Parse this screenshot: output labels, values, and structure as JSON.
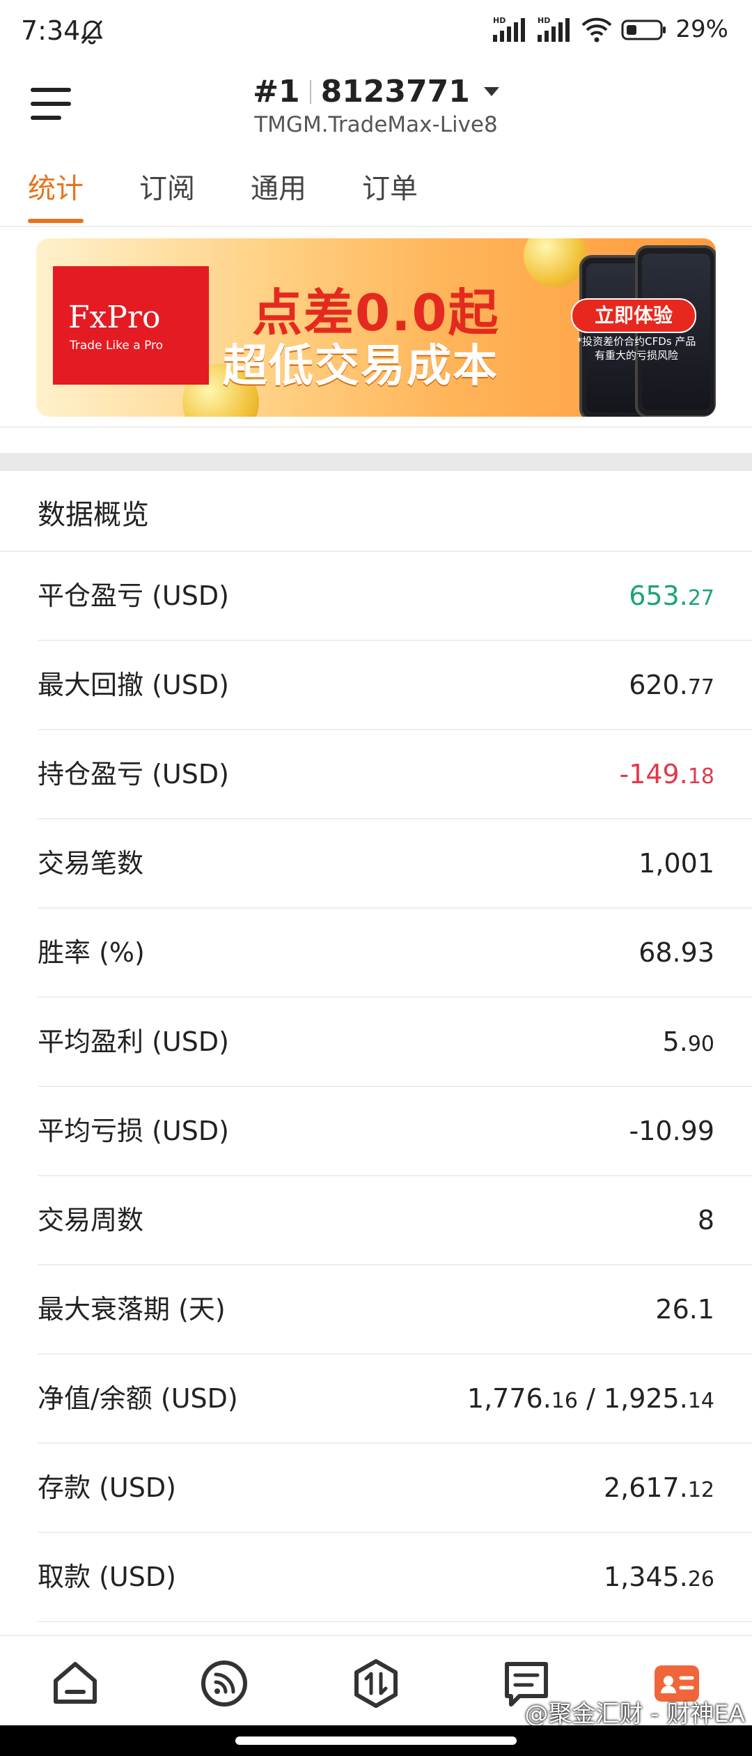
{
  "status_bar": {
    "time": "7:34",
    "battery": "29%",
    "signal_labels": [
      "HD",
      "HD"
    ],
    "icons": [
      "bell-off-icon",
      "signal-icon",
      "signal-icon",
      "wifi-icon",
      "battery-icon"
    ]
  },
  "header": {
    "account_prefix": "#1",
    "account_number": "8123771",
    "server": "TMGM.TradeMax-Live8"
  },
  "tabs": [
    {
      "label": "统计",
      "active": true
    },
    {
      "label": "订阅",
      "active": false
    },
    {
      "label": "通用",
      "active": false
    },
    {
      "label": "订单",
      "active": false
    }
  ],
  "banner": {
    "brand": "FxPro",
    "brand_tagline": "Trade Like a Pro",
    "headline": "点差0.0起",
    "subheadline": "超低交易成本",
    "cta": "立即体验",
    "disclaimer": "*投资差价合约CFDs 产品有重大的亏损风险"
  },
  "overview": {
    "title": "数据概览",
    "rows": [
      {
        "label": "平仓盈亏 (USD)",
        "value_main": "653.",
        "value_small": "27",
        "tone": "pos"
      },
      {
        "label": "最大回撤 (USD)",
        "value_main": "620.",
        "value_small": "77",
        "tone": "normal"
      },
      {
        "label": "持仓盈亏 (USD)",
        "value_main": "-149.",
        "value_small": "18",
        "tone": "neg"
      },
      {
        "label": "交易笔数",
        "value_main": "1,001",
        "value_small": "",
        "tone": "normal"
      },
      {
        "label": "胜率 (%)",
        "value_main": "68.93",
        "value_small": "",
        "tone": "normal"
      },
      {
        "label": "平均盈利 (USD)",
        "value_main": "5.",
        "value_small": "90",
        "tone": "normal"
      },
      {
        "label": "平均亏损 (USD)",
        "value_main": "-10.99",
        "value_small": "",
        "tone": "normal"
      },
      {
        "label": "交易周数",
        "value_main": "8",
        "value_small": "",
        "tone": "normal"
      },
      {
        "label": "最大衰落期 (天)",
        "value_main": "26.1",
        "value_small": "",
        "tone": "normal"
      },
      {
        "label": "净值/余额 (USD)",
        "value_main": "1,776.",
        "value_small": "16",
        "value_main2": " / 1,925.",
        "value_small2": "14",
        "tone": "normal"
      },
      {
        "label": "存款 (USD)",
        "value_main": "2,617.",
        "value_small": "12",
        "tone": "normal"
      },
      {
        "label": "取款 (USD)",
        "value_main": "1,345.",
        "value_small": "26",
        "tone": "normal"
      }
    ]
  },
  "bottom_nav": {
    "items": [
      "home-icon",
      "signal-feed-icon",
      "trade-icon",
      "news-icon",
      "profile-card-icon"
    ],
    "active_color": "#f0663a"
  },
  "watermark": "@聚金汇财 - 财神EA",
  "colors": {
    "accent": "#e8731a",
    "positive": "#1aa37a",
    "negative": "#e0394c"
  }
}
